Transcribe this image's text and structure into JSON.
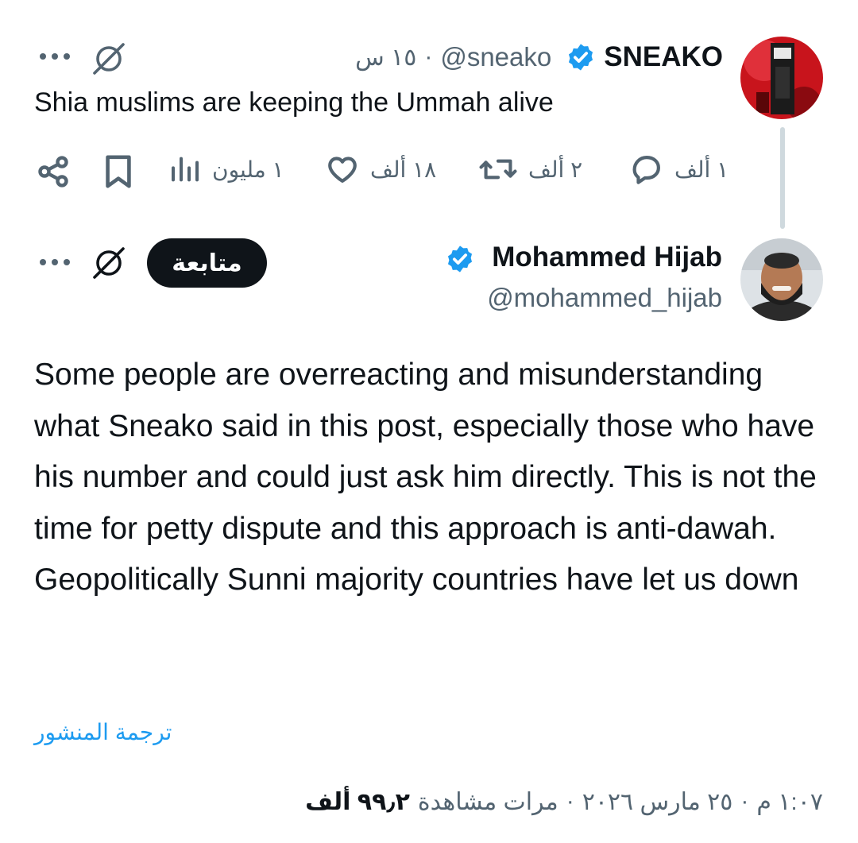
{
  "first_post": {
    "author_name": "SNEAKO",
    "handle": "@sneako",
    "time": "١٥ س",
    "separator": "·",
    "text": "Shia muslims are keeping the Ummah alive",
    "replies": "١ ألف",
    "reposts": "٢ ألف",
    "likes": "١٨ ألف",
    "views": "١ مليون"
  },
  "main_post": {
    "author_name": "Mohammed Hijab",
    "handle": "@mohammed_hijab",
    "follow_label": "متابعة",
    "text": "Some people are overreacting and misunderstanding what Sneako said in this post, especially those who have his number and could just ask him directly. This is not the time for petty dispute and this approach is anti-dawah. Geopolitically Sunni majority countries have let us down",
    "translate_label": "ترجمة المنشور",
    "time": "١:٠٧ م",
    "date": "٢٥ مارس ٢٠٢٦",
    "views_count": "٩٩٫٢ ألف",
    "views_label": "مرات مشاهدة",
    "separator": "·"
  },
  "icons": [
    "grok-icon",
    "more-icon",
    "share-icon",
    "bookmark-icon",
    "views-icon",
    "like-icon",
    "repost-icon",
    "reply-icon",
    "verified-badge-icon"
  ],
  "colors": {
    "accent": "#1d9bf0",
    "text": "#0f1419",
    "muted": "#536471",
    "button_bg": "#0f1419"
  }
}
